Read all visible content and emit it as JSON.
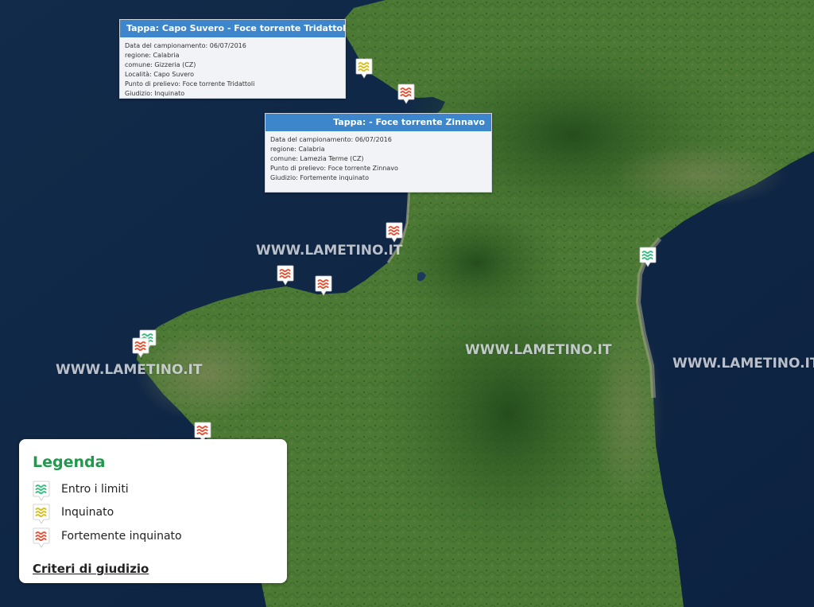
{
  "colors": {
    "sea": "#0f2744",
    "popup_header": "#3d86cc",
    "legend_title": "#1f9a4c",
    "marker_green": "#3fbf86",
    "marker_yellow": "#d9c21a",
    "marker_red": "#e8573a"
  },
  "popups": [
    {
      "title": "Tappa: Capo Suvero - Foce torrente Tridattoli",
      "lines": [
        "Data del campionamento: 06/07/2016",
        "regione: Calabria",
        "comune: Gizzeria (CZ)",
        "Località: Capo Suvero",
        "Punto di prelievo: Foce torrente Tridattoli",
        "Giudizio: Inquinato"
      ]
    },
    {
      "title": "Tappa:  - Foce torrente Zinnavo",
      "lines": [
        "Data del campionamento: 06/07/2016",
        "regione: Calabria",
        "comune: Lamezia Terme (CZ)",
        "Punto di prelievo: Foce torrente Zinnavo",
        "Giudizio: Fortemente inquinato"
      ]
    }
  ],
  "markers": [
    {
      "status": "inquinato",
      "icon": "waves-marker-icon"
    },
    {
      "status": "fortemente",
      "icon": "waves-marker-icon"
    },
    {
      "status": "fortemente",
      "icon": "waves-marker-icon"
    },
    {
      "status": "entro",
      "icon": "waves-marker-icon"
    },
    {
      "status": "fortemente",
      "icon": "waves-marker-icon"
    },
    {
      "status": "fortemente",
      "icon": "waves-marker-icon"
    },
    {
      "status": "entro",
      "icon": "waves-marker-icon"
    },
    {
      "status": "fortemente",
      "icon": "waves-marker-icon"
    },
    {
      "status": "fortemente",
      "icon": "waves-marker-icon"
    }
  ],
  "watermark": "WWW.LAMETINO.IT",
  "legend": {
    "title": "Legenda",
    "items": [
      {
        "label": "Entro i limiti",
        "status": "entro"
      },
      {
        "label": "Inquinato",
        "status": "inquinato"
      },
      {
        "label": "Fortemente inquinato",
        "status": "fortemente"
      }
    ],
    "criteria_link": "Criteri di giudizio"
  }
}
